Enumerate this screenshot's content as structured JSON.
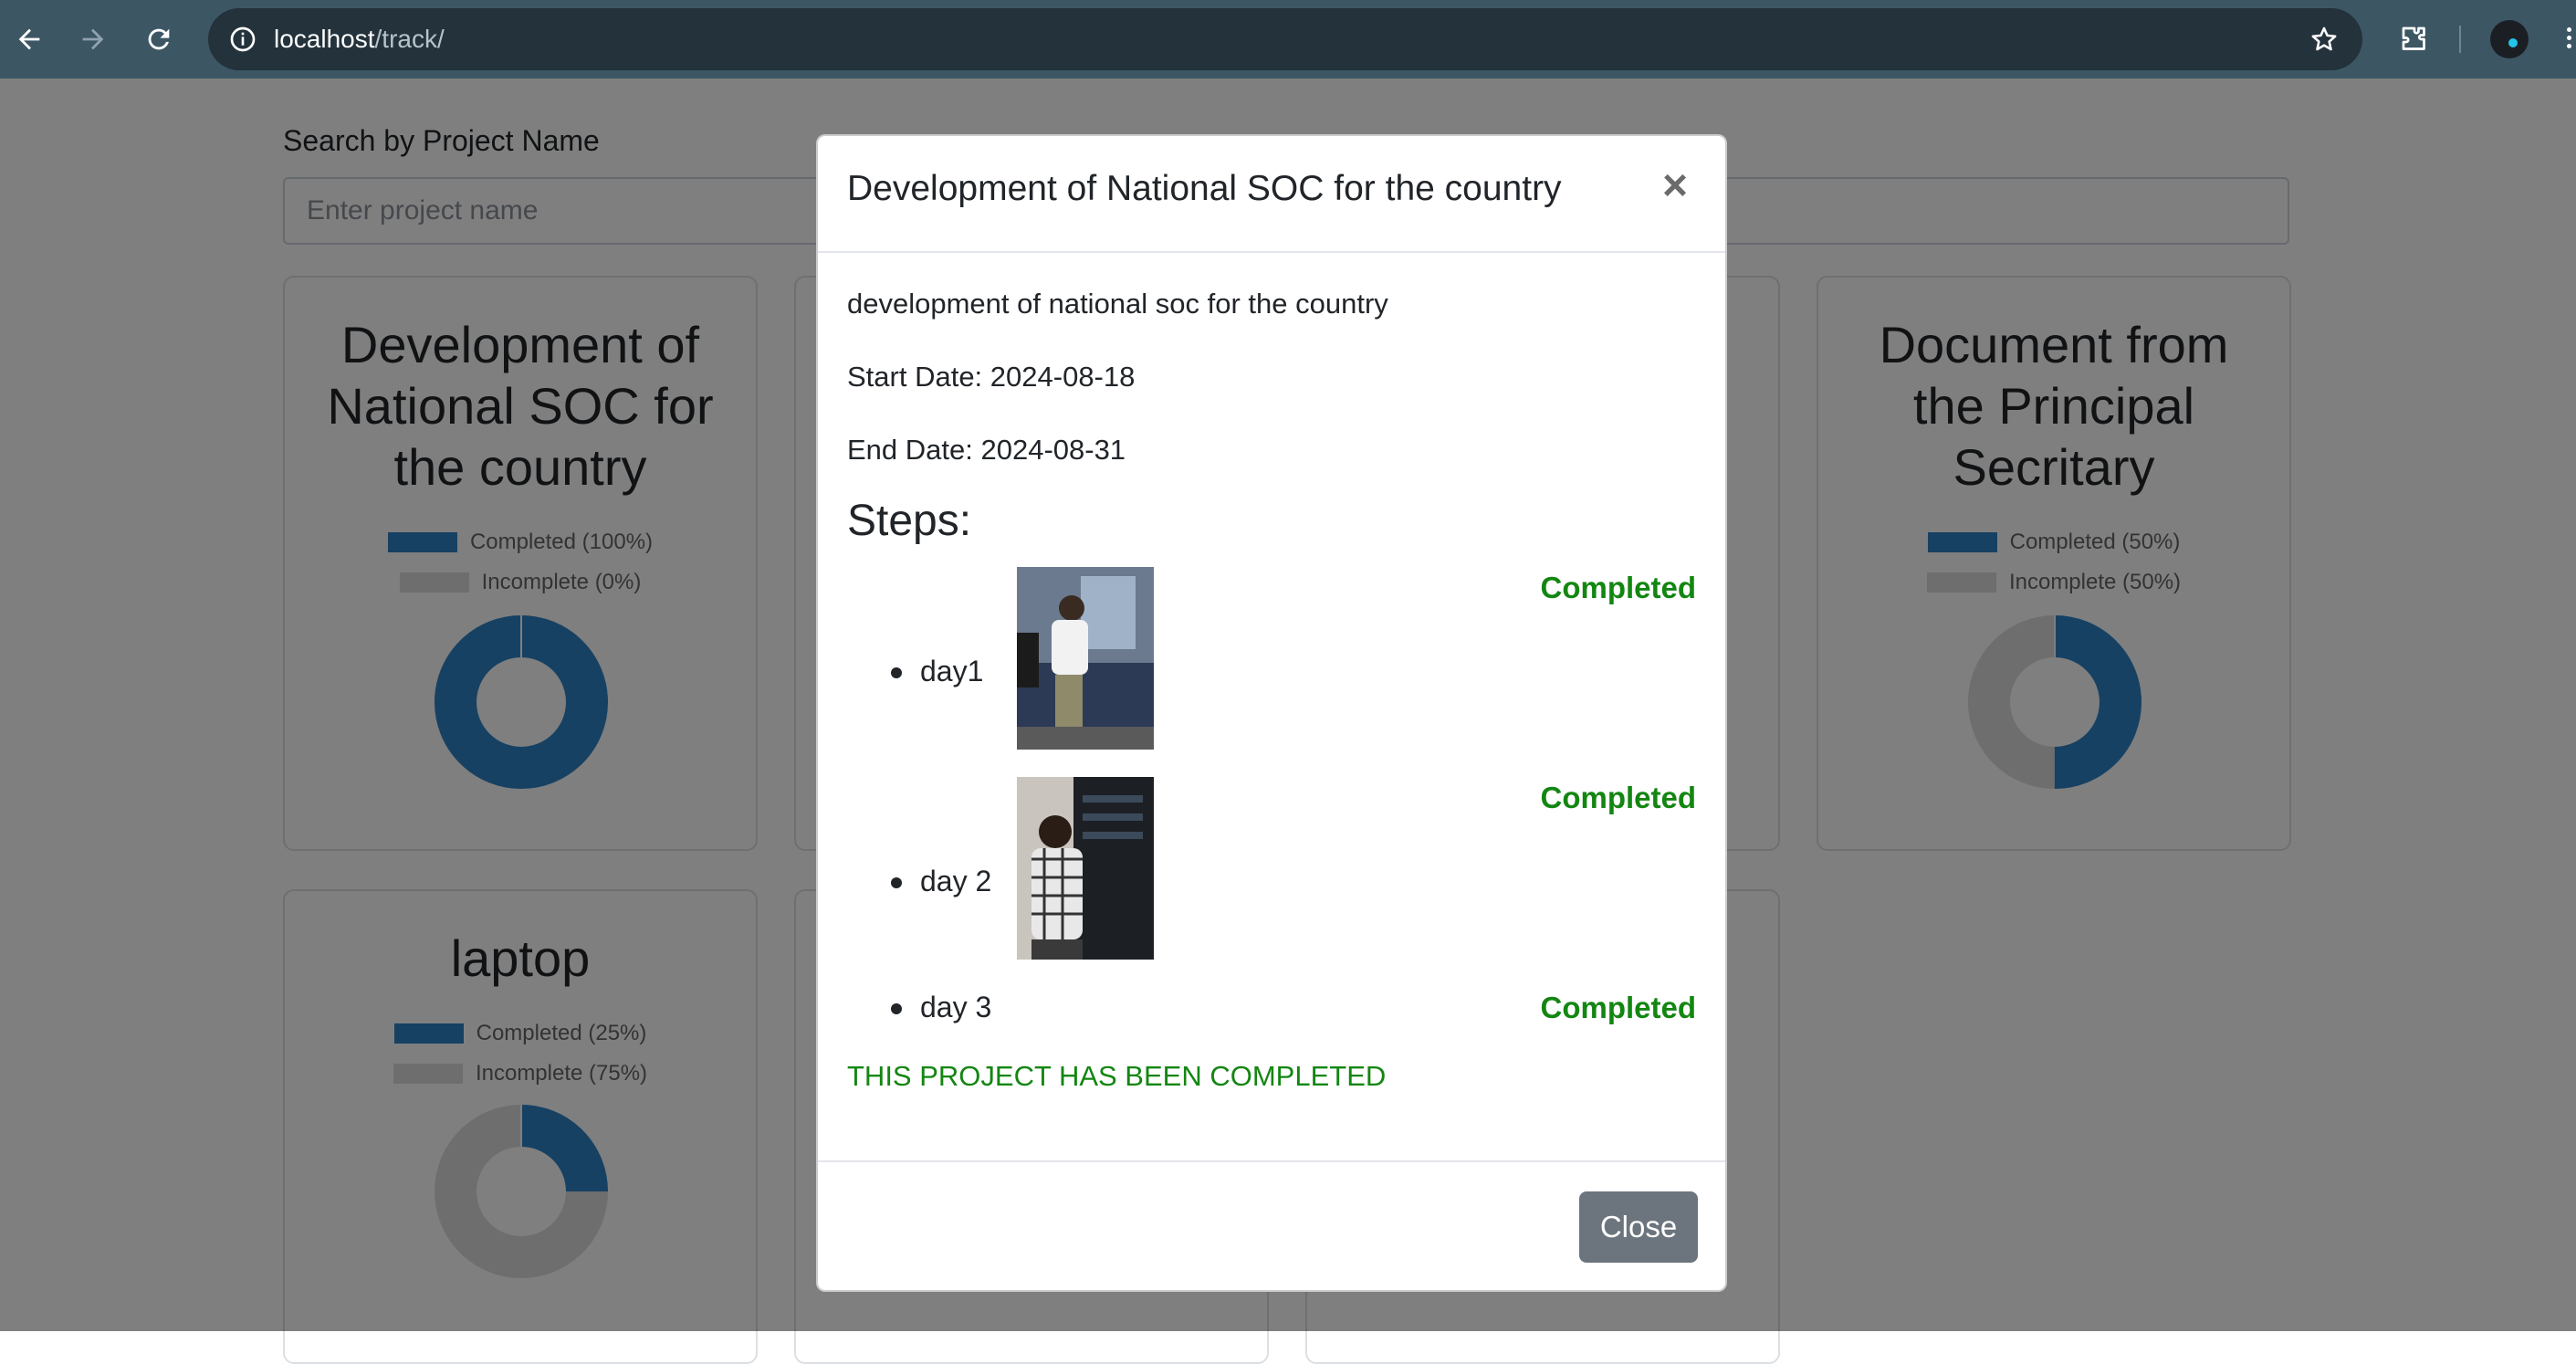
{
  "browser": {
    "url_host": "localhost",
    "url_path": "/track/"
  },
  "search": {
    "label": "Search by Project Name",
    "placeholder": "Enter project name",
    "value": ""
  },
  "cards": [
    {
      "title_lines": [
        "Development of",
        "National SOC for",
        "the country"
      ],
      "legend_completed": "Completed (100%)",
      "legend_incomplete": "Incomplete (0%)",
      "completed_fraction": 1.0
    },
    {
      "title_lines": [
        "Document from",
        "the Principal",
        "Secritary"
      ],
      "legend_completed": "Completed (50%)",
      "legend_incomplete": "Incomplete (50%)",
      "completed_fraction": 0.5
    },
    {
      "title_lines": [
        "laptop"
      ],
      "legend_completed": "Completed (25%)",
      "legend_incomplete": "Incomplete (75%)",
      "completed_fraction": 0.25
    }
  ],
  "colors": {
    "completed": "#2d82c6",
    "incomplete": "#dcdcdc",
    "success_text": "#138612",
    "secondary_button": "#6c757d"
  },
  "modal": {
    "title": "Development of National SOC for the country",
    "close_x": "×",
    "description": "development of national soc for the country",
    "start_date": "Start Date: 2024-08-18",
    "end_date": "End Date: 2024-08-31",
    "steps_heading": "Steps:",
    "steps": [
      {
        "name": "day1",
        "status": "Completed",
        "has_image": true
      },
      {
        "name": "day 2",
        "status": "Completed",
        "has_image": true
      },
      {
        "name": "day 3",
        "status": "Completed",
        "has_image": false
      }
    ],
    "completion_message": "THIS PROJECT HAS BEEN COMPLETED",
    "close_button": "Close"
  }
}
